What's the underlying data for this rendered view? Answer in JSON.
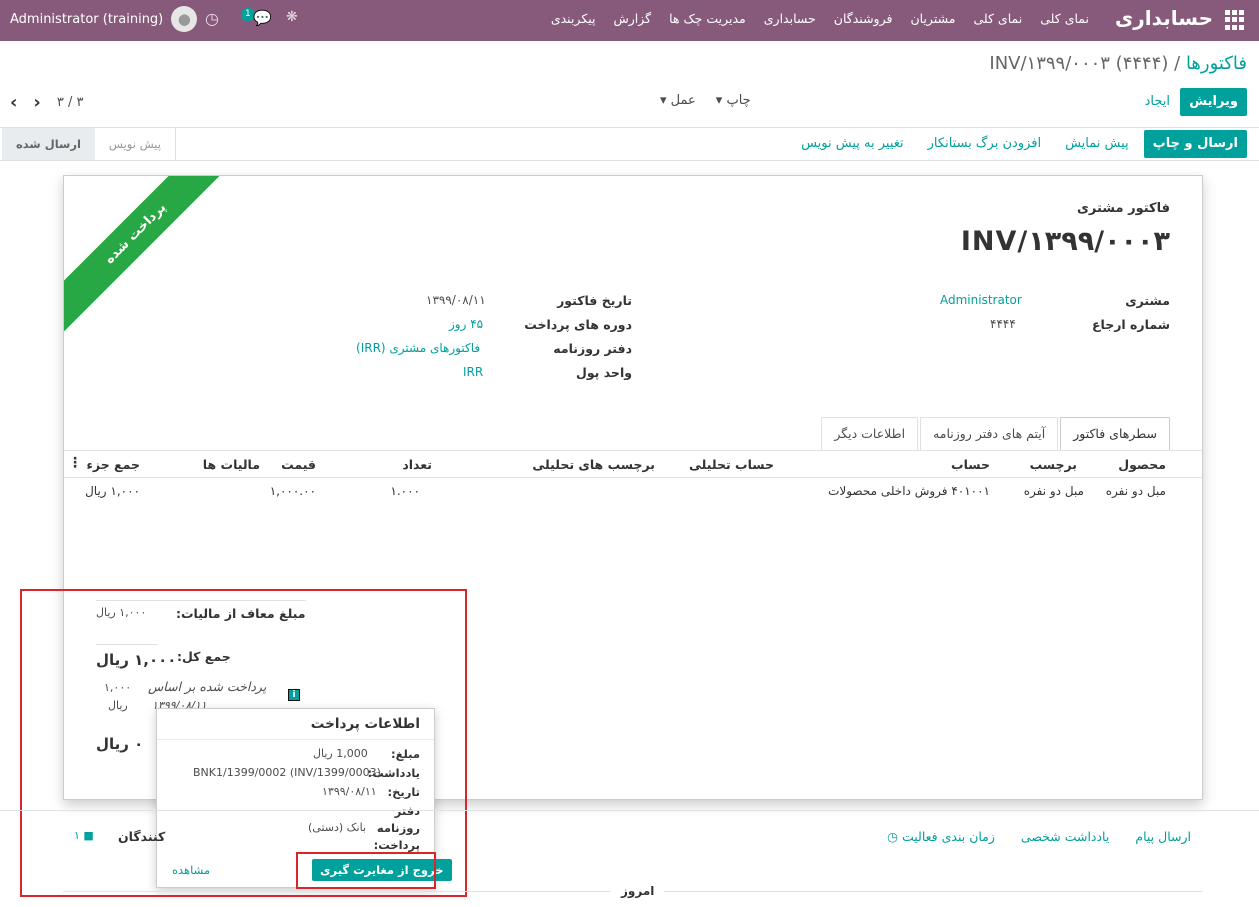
{
  "navbar": {
    "brand": "حسابداری",
    "menu": [
      "نمای کلی",
      "نمای کلی",
      "مشتریان",
      "فروشندگان",
      "حسابداری",
      "مدیریت چک ها",
      "گزارش",
      "پیکربندی"
    ],
    "user": "Administrator (training)",
    "chat_count": "1",
    "bg_color": "#875a7b"
  },
  "breadcrumb": {
    "parent": "فاکتورها",
    "separator": "/",
    "current": "INV/۱۳۹۹/۰۰۰۳ (۴۴۴۴)"
  },
  "control": {
    "edit_label": "ویرایش",
    "create_label": "ایجاد",
    "print_label": "چاپ",
    "action_label": "عمل",
    "pager_text": "۳ / ۳"
  },
  "statusbar": {
    "buttons": [
      "ارسال و چاپ",
      "پیش نمایش",
      "افزودن برگ بستانکار",
      "تغییر به پیش نویس"
    ],
    "stages": [
      "پیش نویس",
      "ارسال شده"
    ],
    "active_stage": "ارسال شده"
  },
  "invoice": {
    "ribbon": "پرداخت شده",
    "doc_type": "فاکتور مشتری",
    "name": "INV/۱۳۹۹/۰۰۰۳",
    "customer_label": "مشتری",
    "customer": "Administrator",
    "ref_label": "شماره ارجاع",
    "ref": "۴۴۴۴",
    "date_label": "تاریخ فاکتور",
    "date": "۱۳۹۹/۰۸/۱۱",
    "terms_label": "دوره های پرداخت",
    "terms": "۴۵ روز",
    "journal_label": "دفتر روزنامه",
    "journal": "فاکتورهای مشتری (IRR)",
    "currency_label": "واحد پول",
    "currency": "IRR"
  },
  "tabs": [
    "سطرهای فاکتور",
    "آیتم های دفتر روزنامه",
    "اطلاعات دیگر"
  ],
  "table": {
    "headers": [
      "محصول",
      "برچسب",
      "حساب",
      "حساب تحلیلی",
      "برچسب های تحلیلی",
      "تعداد",
      "قیمت",
      "مالیات ها",
      "جمع جزء"
    ],
    "rows": [
      [
        "مبل دو نفره",
        "مبل دو نفره",
        "۴۰۱۰۰۱ فروش داخلی محصولات",
        "",
        "",
        "۱.۰۰۰",
        "۱,۰۰۰.۰۰",
        "",
        "۱,۰۰۰ ریال"
      ]
    ]
  },
  "totals": {
    "untaxed_label": "مبلغ معاف از مالیات:",
    "untaxed": "۱,۰۰۰ ریال",
    "total_label": "جمع کل:",
    "total": "۱,۰۰۰ ریال",
    "paid_label": "پرداخت شده بر اساس",
    "paid_date": "۱۳۹۹/۰۸/۱۱",
    "paid_amount": "۱,۰۰۰",
    "paid_currency": "ریال",
    "residual": "۰ ریال"
  },
  "popover": {
    "title": "اطلاعات پرداخت",
    "amount_label": "مبلغ:",
    "amount": "1,000 ریال",
    "memo_label": "یادداشت:",
    "memo": "BNK1/1399/0002 (INV/1399/0003)",
    "date_label": "تاریخ:",
    "date": "۱۳۹۹/۰۸/۱۱",
    "journal_label_1": "دفتر",
    "journal_label_2": "روزنامه",
    "journal_label_3": "پرداخت:",
    "journal": "بانک (دستی)",
    "unreconcile_label": "خروج از مغایرت گیری",
    "view_label": "مشاهده"
  },
  "chatter": {
    "send_message": "ارسال پیام",
    "log_note": "یادداشت شخصی",
    "schedule": "زمان بندی فعالیت",
    "followers_label": "کنندگان",
    "followers_count": "۱",
    "today": "امروز"
  }
}
